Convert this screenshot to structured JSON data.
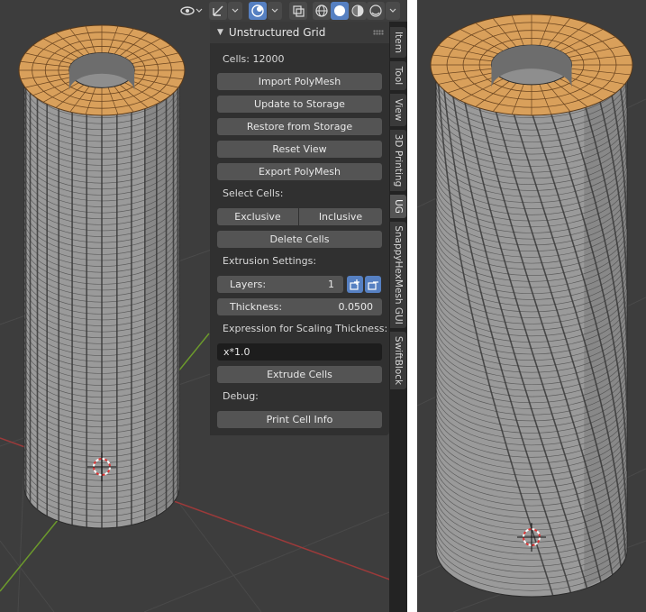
{
  "panel": {
    "title": "Unstructured Grid",
    "cells_label": "Cells: 12000",
    "buttons": {
      "import": "Import PolyMesh",
      "update": "Update to Storage",
      "restore": "Restore from Storage",
      "reset": "Reset View",
      "export": "Export PolyMesh"
    },
    "select_cells_label": "Select Cells:",
    "exclusive": "Exclusive",
    "inclusive": "Inclusive",
    "delete_cells": "Delete Cells",
    "extrusion_settings_label": "Extrusion Settings:",
    "layers_label": "Layers:",
    "layers_value": "1",
    "thickness_label": "Thickness:",
    "thickness_value": "0.0500",
    "expression_label": "Expression for Scaling Thickness:",
    "expression_value": "x*1.0",
    "extrude_cells": "Extrude Cells",
    "debug_label": "Debug:",
    "print_cell_info": "Print Cell Info"
  },
  "tabs": [
    "Item",
    "Tool",
    "View",
    "3D Printing",
    "UG",
    "SnappyHexMesh GUI",
    "SwiftBlock"
  ],
  "active_tab": "UG",
  "colors": {
    "viewport_bg": "#3d3d3d",
    "panel_bg": "#303030",
    "button": "#545454",
    "accent": "#5680c2",
    "mesh_face": "#9a9a9a",
    "mesh_selected": "#d9a05b"
  },
  "icons": [
    "eye-icon",
    "gizmo-icon",
    "overlay-icon",
    "xray-icon",
    "wireframe-shading-icon",
    "solid-shading-icon",
    "material-shading-icon",
    "rendered-shading-icon",
    "3d-cursor-icon"
  ]
}
